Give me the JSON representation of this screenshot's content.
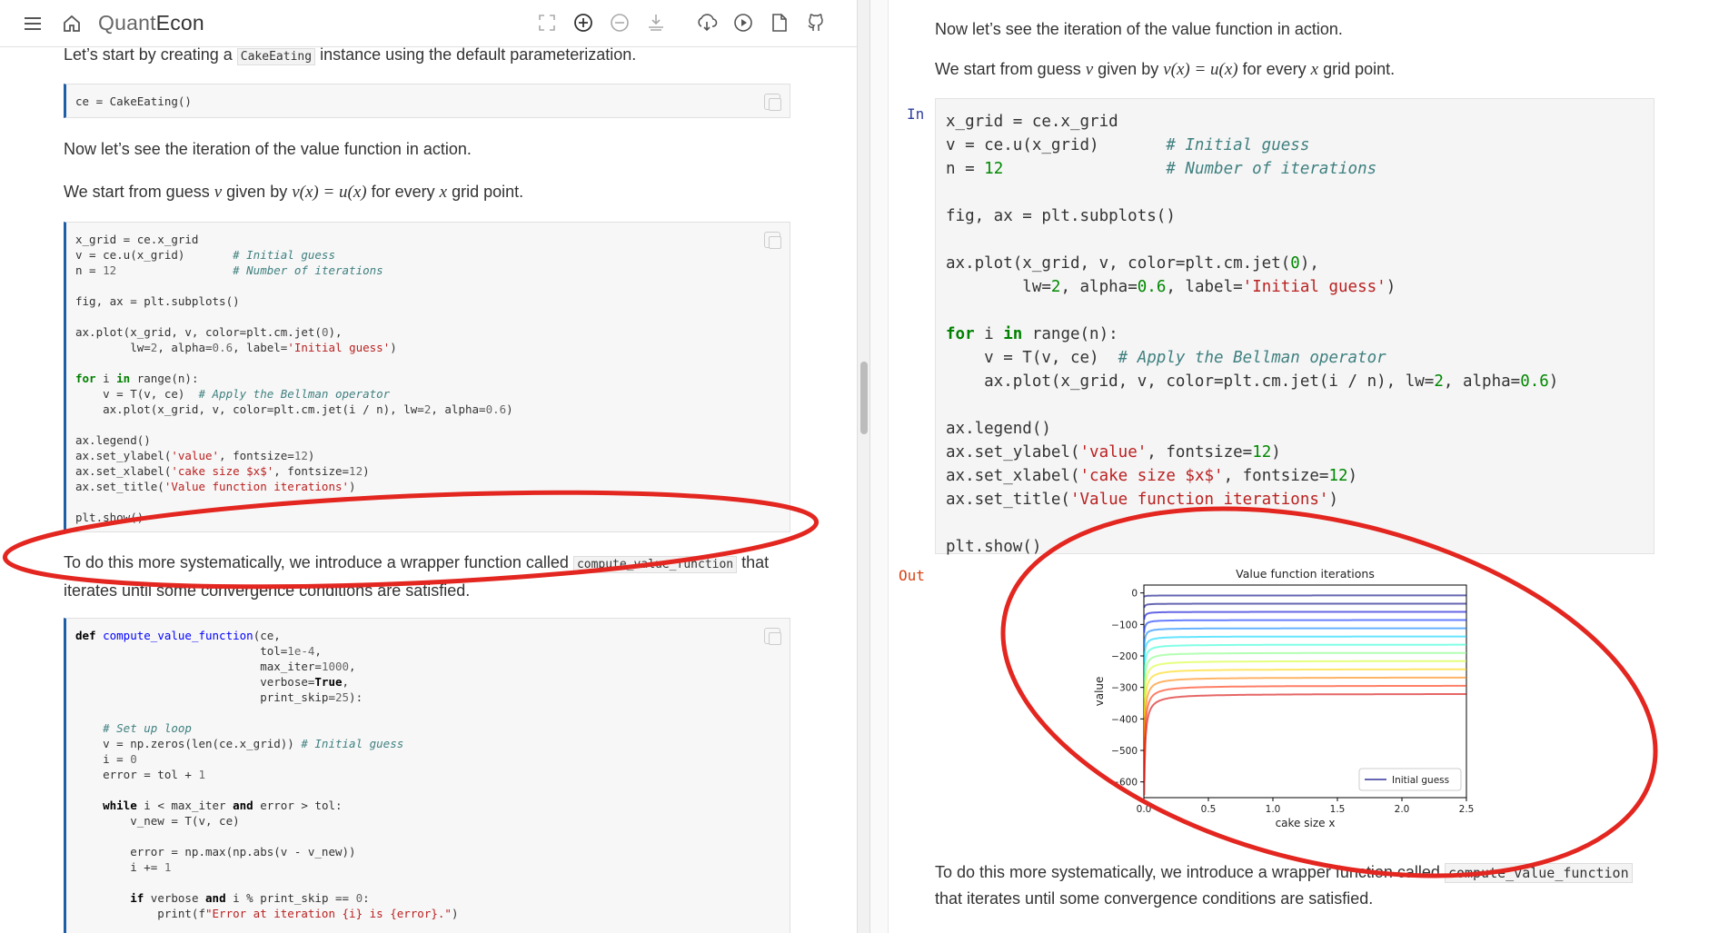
{
  "topbar": {
    "brand_quant": "Quant",
    "brand_econ": "Econ",
    "icons": [
      "menu-icon",
      "home-icon",
      "fullscreen-icon",
      "plus-icon",
      "minus-icon",
      "launch-icon",
      "download-icon",
      "play-icon",
      "file-icon",
      "github-icon"
    ]
  },
  "left": {
    "p1_before": "Let’s start by creating a ",
    "p1_code": "CakeEating",
    "p1_after": " instance using the default parameterization.",
    "code1": "ce = CakeEating()",
    "p2": "Now let’s see the iteration of the value function in action.",
    "p3_before": "We start from guess ",
    "p3_v": "v",
    "p3_mid": " given by ",
    "p3_eq": "v(x) = u(x)",
    "p3_for": " for every ",
    "p3_x": "x",
    "p3_after": " grid point.",
    "p4_before": "To do this more systematically, we introduce a wrapper function called ",
    "p4_code": "compute_value_function",
    "p4_after": " that",
    "p4_line2": "iterates until some convergence conditions are satisfied."
  },
  "right": {
    "p1": "Now let’s see the iteration of the value function in action.",
    "p2_before": "We start from guess ",
    "p2_v": "v",
    "p2_mid": " given by ",
    "p2_eq": "v(x) = u(x)",
    "p2_for": " for every ",
    "p2_x": "x",
    "p2_after": " grid point.",
    "prompt_in": "In",
    "prompt_out": "Out",
    "p3_before": "To do this more systematically, we introduce a wrapper function called ",
    "p3_code": "compute_value_function",
    "p3_line2": "that iterates until some convergence conditions are satisfied."
  },
  "chart_data": {
    "type": "line",
    "title": "Value function iterations",
    "xlabel": "cake size x",
    "ylabel": "value",
    "xlim": [
      0,
      2.5
    ],
    "ylim": [
      -650,
      25
    ],
    "xticks": [
      "0.0",
      "0.5",
      "1.0",
      "1.5",
      "2.0",
      "2.5"
    ],
    "yticks": [
      "0",
      "−100",
      "−200",
      "−300",
      "−400",
      "−500",
      "−600"
    ],
    "ytick_values": [
      0,
      -100,
      -200,
      -300,
      -400,
      -500,
      -600
    ],
    "legend": [
      "Initial guess"
    ],
    "legend_position": "lower-right",
    "series_count": 13,
    "colormap": "jet",
    "first_series_color": "#00007f"
  }
}
